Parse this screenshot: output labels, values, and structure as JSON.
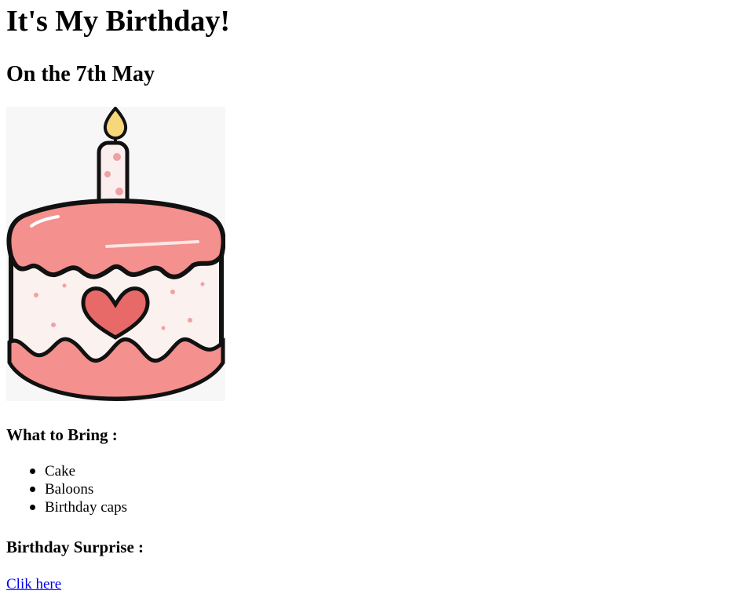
{
  "page": {
    "title": "It's My Birthday!",
    "date_heading": "On the 7th May"
  },
  "image": {
    "icon": "birthday-cake-icon"
  },
  "bring": {
    "heading": "What to Bring :",
    "items": [
      {
        "label": "Cake"
      },
      {
        "label": "Baloons"
      },
      {
        "label": "Birthday caps"
      }
    ]
  },
  "surprise": {
    "heading": "Birthday Surprise :",
    "link_text": "Clik here",
    "link_color": "#0000ee"
  }
}
